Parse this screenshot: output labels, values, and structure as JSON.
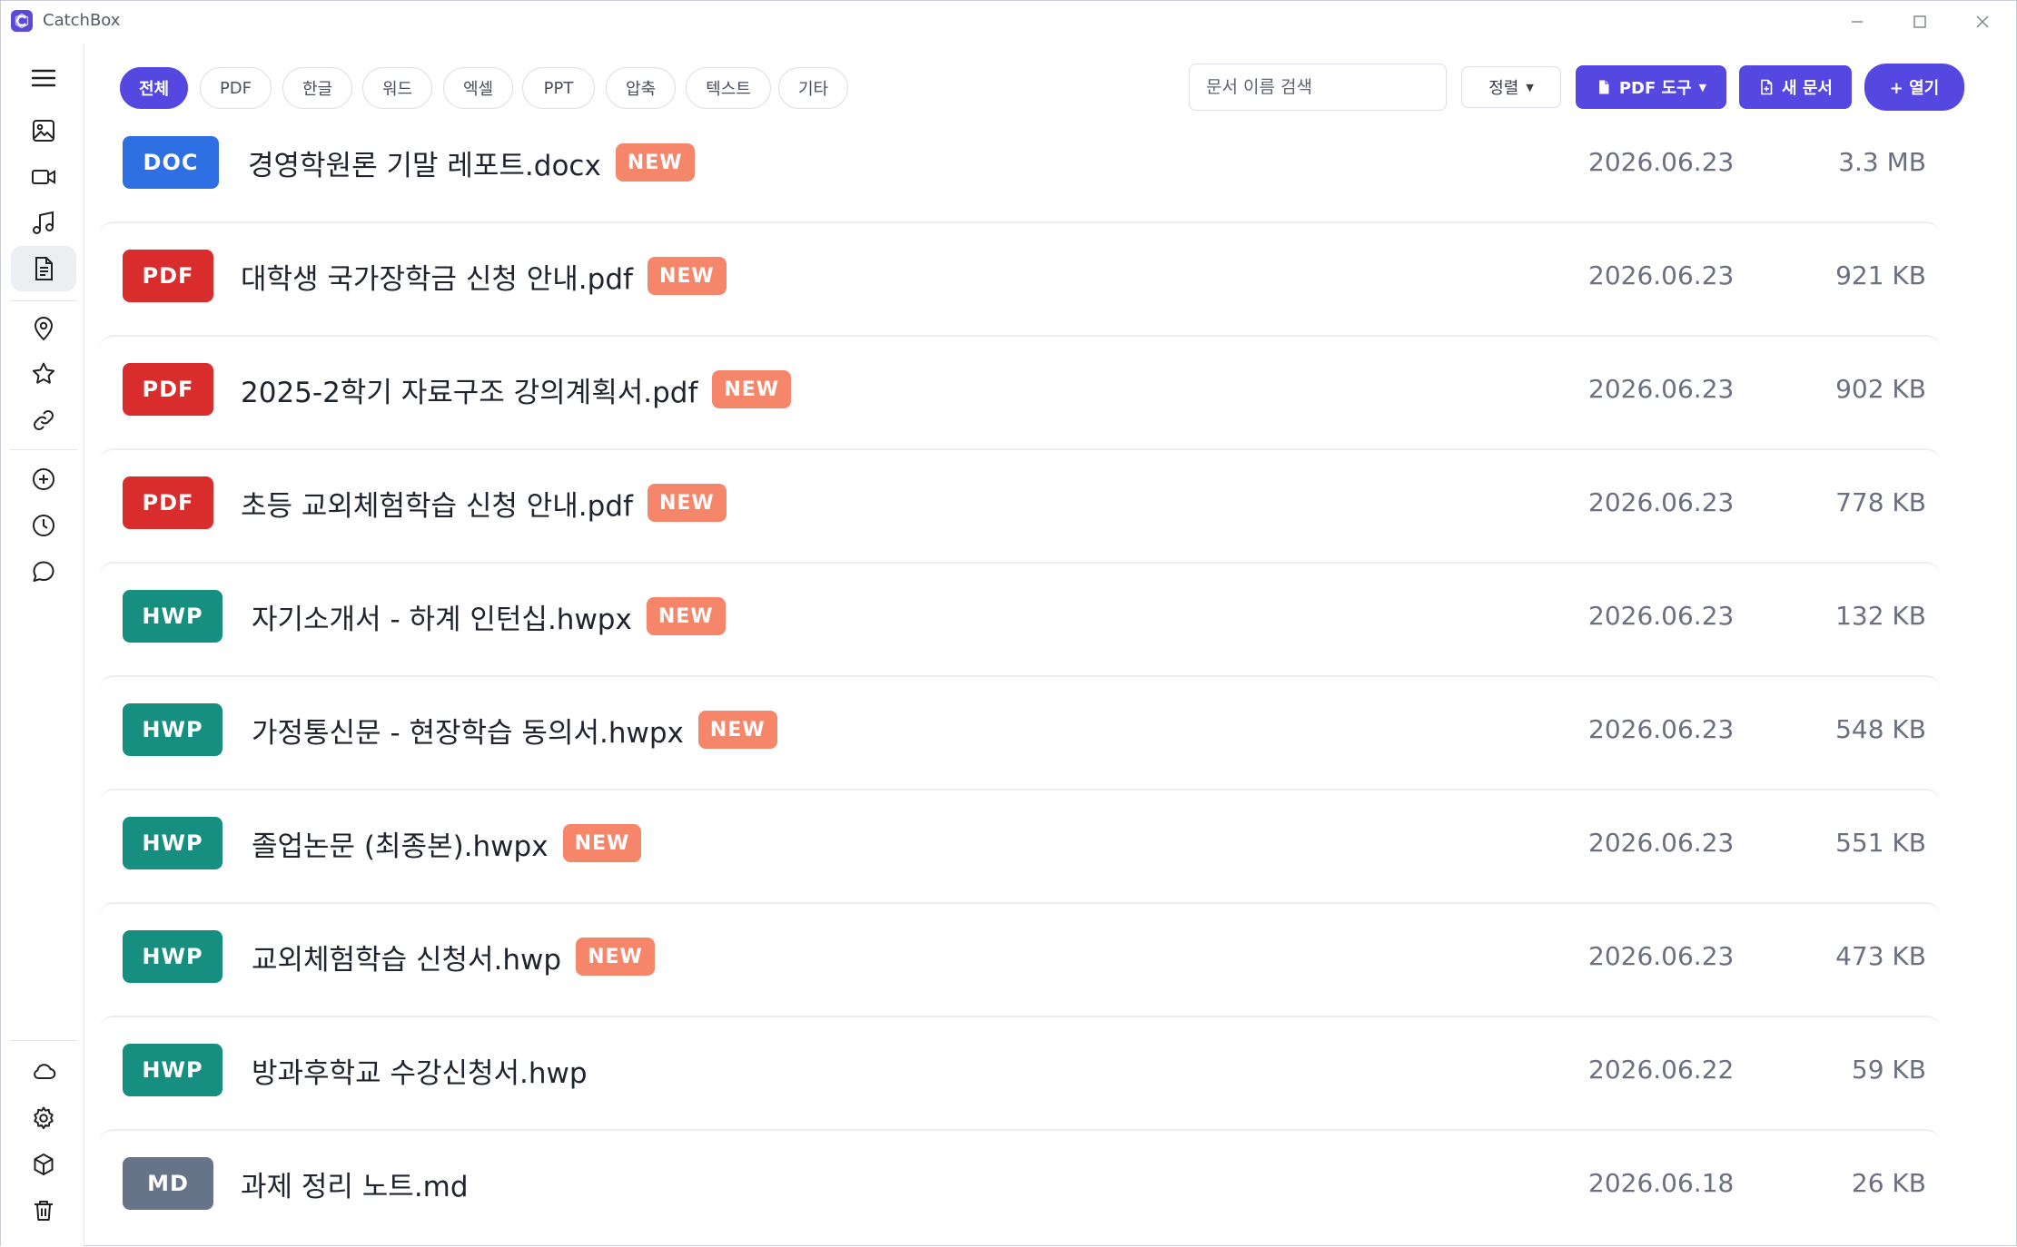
{
  "window": {
    "title": "CatchBox",
    "controls": {
      "minimize": "minimize-icon",
      "maximize": "maximize-icon",
      "close": "close-icon"
    }
  },
  "sidebar": {
    "items": [
      {
        "name": "menu",
        "icon": "hamburger-icon",
        "active": false
      },
      {
        "name": "images",
        "icon": "image-icon",
        "active": false
      },
      {
        "name": "videos",
        "icon": "video-icon",
        "active": false
      },
      {
        "name": "music",
        "icon": "music-icon",
        "active": false
      },
      {
        "name": "documents",
        "icon": "document-icon",
        "active": true
      },
      {
        "name": "locations",
        "icon": "location-pin-icon",
        "active": false
      },
      {
        "name": "favorites",
        "icon": "star-icon",
        "active": false
      },
      {
        "name": "links",
        "icon": "link-icon",
        "active": false
      },
      {
        "name": "add",
        "icon": "plus-circle-icon",
        "active": false
      },
      {
        "name": "recent",
        "icon": "clock-icon",
        "active": false
      },
      {
        "name": "chat",
        "icon": "chat-bubble-icon",
        "active": false
      },
      {
        "name": "cloud",
        "icon": "cloud-icon",
        "active": false
      },
      {
        "name": "settings",
        "icon": "gear-icon",
        "active": false
      },
      {
        "name": "packages",
        "icon": "cube-icon",
        "active": false
      },
      {
        "name": "trash",
        "icon": "trash-icon",
        "active": false
      }
    ]
  },
  "toolbar": {
    "filters": [
      "전체",
      "PDF",
      "한글",
      "워드",
      "엑셀",
      "PPT",
      "압축",
      "텍스트",
      "기타"
    ],
    "active_filter": "전체",
    "search_placeholder": "문서 이름 검색",
    "sort_label": "정렬",
    "pdf_tools_label": "PDF 도구",
    "new_doc_label": "새 문서",
    "open_label": "+ 열기",
    "accent_color": "#5548e0"
  },
  "files": [
    {
      "type": "DOC",
      "type_color": "#2f6fe4",
      "name": "경영학원론 기말 레포트.docx",
      "is_new": true,
      "new_label": "NEW",
      "date": "2026.06.23",
      "size": "3.3 MB"
    },
    {
      "type": "PDF",
      "type_color": "#d92d2d",
      "name": "대학생 국가장학금 신청 안내.pdf",
      "is_new": true,
      "new_label": "NEW",
      "date": "2026.06.23",
      "size": "921 KB"
    },
    {
      "type": "PDF",
      "type_color": "#d92d2d",
      "name": "2025-2학기 자료구조 강의계획서.pdf",
      "is_new": true,
      "new_label": "NEW",
      "date": "2026.06.23",
      "size": "902 KB"
    },
    {
      "type": "PDF",
      "type_color": "#d92d2d",
      "name": "초등 교외체험학습 신청 안내.pdf",
      "is_new": true,
      "new_label": "NEW",
      "date": "2026.06.23",
      "size": "778 KB"
    },
    {
      "type": "HWP",
      "type_color": "#168f80",
      "name": "자기소개서 - 하계 인턴십.hwpx",
      "is_new": true,
      "new_label": "NEW",
      "date": "2026.06.23",
      "size": "132 KB"
    },
    {
      "type": "HWP",
      "type_color": "#168f80",
      "name": "가정통신문 - 현장학습 동의서.hwpx",
      "is_new": true,
      "new_label": "NEW",
      "date": "2026.06.23",
      "size": "548 KB"
    },
    {
      "type": "HWP",
      "type_color": "#168f80",
      "name": "졸업논문 (최종본).hwpx",
      "is_new": true,
      "new_label": "NEW",
      "date": "2026.06.23",
      "size": "551 KB"
    },
    {
      "type": "HWP",
      "type_color": "#168f80",
      "name": "교외체험학습 신청서.hwp",
      "is_new": true,
      "new_label": "NEW",
      "date": "2026.06.23",
      "size": "473 KB"
    },
    {
      "type": "HWP",
      "type_color": "#168f80",
      "name": "방과후학교 수강신청서.hwp",
      "is_new": false,
      "date": "2026.06.22",
      "size": "59 KB"
    },
    {
      "type": "MD",
      "type_color": "#677389",
      "name": "과제 정리 노트.md",
      "is_new": false,
      "date": "2026.06.18",
      "size": "26 KB"
    }
  ]
}
